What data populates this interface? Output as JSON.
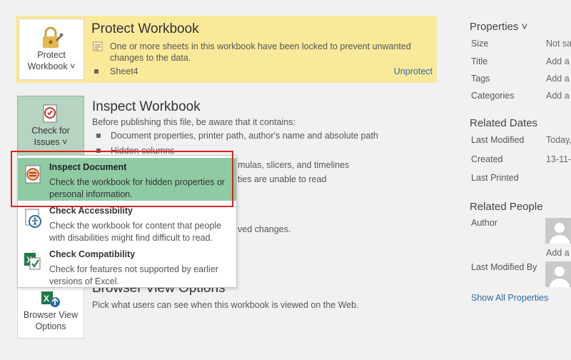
{
  "protect": {
    "title": "Protect Workbook",
    "button_line1": "Protect",
    "button_line2": "Workbook ˅",
    "description": "One or more sheets in this workbook have been locked to prevent unwanted changes to the data.",
    "sheet": "Sheet4",
    "unprotect_link": "Unprotect"
  },
  "inspect": {
    "title": "Inspect Workbook",
    "button_line1": "Check for",
    "button_line2": "Issues ˅",
    "intro": "Before publishing this file, be aware that it contains:",
    "items": [
      "Document properties, printer path, author's name and absolute path",
      "Hidden columns",
      "mulas, slicers, and timelines",
      "ties are unable to read",
      "ved changes."
    ]
  },
  "dropdown": {
    "items": [
      {
        "title": "Inspect Document",
        "desc": "Check the workbook for hidden properties or personal information."
      },
      {
        "title": "Check Accessibility",
        "desc": "Check the workbook for content that people with disabilities might find difficult to read."
      },
      {
        "title": "Check Compatibility",
        "desc": "Check for features not supported by earlier versions of Excel."
      }
    ]
  },
  "browser": {
    "title": "Browser View Options",
    "button_line1": "Browser View",
    "button_line2": "Options",
    "description": "Pick what users can see when this workbook is viewed on the Web."
  },
  "properties": {
    "heading": "Properties ˅",
    "rows": [
      {
        "label": "Size",
        "value": "Not sa"
      },
      {
        "label": "Title",
        "value": "Add a"
      },
      {
        "label": "Tags",
        "value": "Add a"
      },
      {
        "label": "Categories",
        "value": "Add a"
      }
    ]
  },
  "related_dates": {
    "heading": "Related Dates",
    "rows": [
      {
        "label": "Last Modified",
        "value": "Today,"
      },
      {
        "label": "Created",
        "value": "13-11-"
      },
      {
        "label": "Last Printed",
        "value": ""
      }
    ]
  },
  "related_people": {
    "heading": "Related People",
    "author_label": "Author",
    "add_author": "Add a",
    "last_modified_by_label": "Last Modified By",
    "show_all": "Show All Properties"
  },
  "colors": {
    "protect_bg": "#fbe99a",
    "check_button_bg": "#b7d3c1",
    "highlight_item_bg": "#8fcba2",
    "annotation_red": "#e02020",
    "link_blue": "#2b6ca3"
  }
}
